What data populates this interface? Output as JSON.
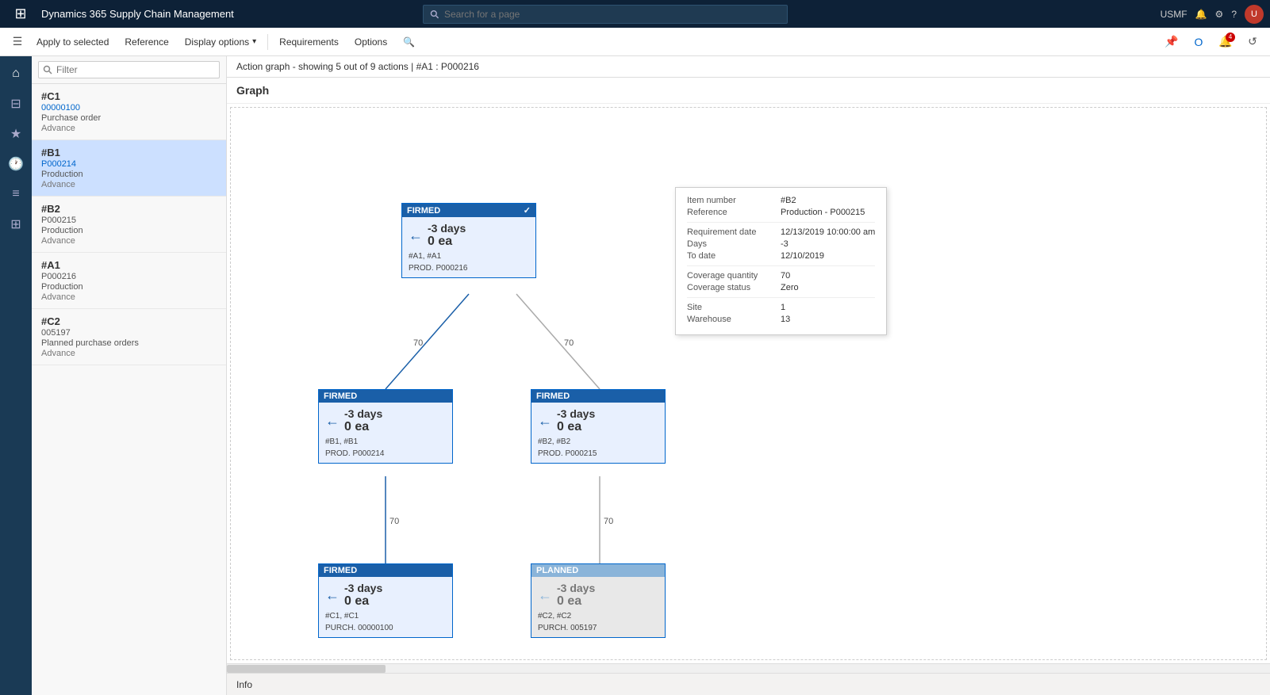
{
  "app": {
    "title": "Dynamics 365 Supply Chain Management",
    "app_icon": "⊞"
  },
  "search": {
    "placeholder": "Search for a page"
  },
  "topbar": {
    "user": "USMF"
  },
  "ribbon": {
    "apply_to_selected": "Apply to selected",
    "reference": "Reference",
    "display_options": "Display options",
    "requirements": "Requirements",
    "options": "Options"
  },
  "content": {
    "action_info": "Action graph - showing 5 out of 9 actions  |  #A1 : P000216",
    "graph_label": "Graph"
  },
  "list_items": [
    {
      "id": "#C1",
      "code": "00000100",
      "type": "Purchase order",
      "label": "Advance"
    },
    {
      "id": "#B1",
      "code": "P000214",
      "type": "Production",
      "label": "Advance",
      "selected": true
    },
    {
      "id": "#B2",
      "code": "P000215",
      "type": "Production",
      "label": "Advance"
    },
    {
      "id": "#A1",
      "code": "P000216",
      "type": "Production",
      "label": "Advance"
    },
    {
      "id": "#C2",
      "code": "005197",
      "type": "Planned purchase orders",
      "label": "Advance"
    }
  ],
  "nodes": {
    "top": {
      "status": "FIRMED",
      "days": "-3 days",
      "qty": "0 ea",
      "refs": "#A1, #A1",
      "prod": "PROD. P000216"
    },
    "mid_left": {
      "status": "FIRMED",
      "days": "-3 days",
      "qty": "0 ea",
      "refs": "#B1, #B1",
      "prod": "PROD. P000214"
    },
    "mid_right": {
      "status": "FIRMED",
      "days": "-3 days",
      "qty": "0 ea",
      "refs": "#B2, #B2",
      "prod": "PROD. P000215"
    },
    "bot_left": {
      "status": "FIRMED",
      "days": "-3 days",
      "qty": "0 ea",
      "refs": "#C1, #C1",
      "prod": "PURCH. 00000100"
    },
    "bot_right": {
      "status": "PLANNED",
      "days": "-3 days",
      "qty": "0 ea",
      "refs": "#C2, #C2",
      "prod": "PURCH. 005197"
    }
  },
  "edge_labels": {
    "top_mid_left": "70",
    "top_mid_right": "70",
    "mid_left_bot_left": "70",
    "mid_right_bot_right": "70"
  },
  "tooltip": {
    "item_number_label": "Item number",
    "item_number_val": "#B2",
    "reference_label": "Reference",
    "reference_val": "Production - P000215",
    "req_date_label": "Requirement date",
    "req_date_val": "12/13/2019 10:00:00 am",
    "days_label": "Days",
    "days_val": "-3",
    "to_date_label": "To date",
    "to_date_val": "12/10/2019",
    "cov_qty_label": "Coverage quantity",
    "cov_qty_val": "70",
    "cov_status_label": "Coverage status",
    "cov_status_val": "Zero",
    "site_label": "Site",
    "site_val": "1",
    "warehouse_label": "Warehouse",
    "warehouse_val": "13"
  },
  "bottom_bar": {
    "info_label": "Info"
  },
  "filter_placeholder": "Filter"
}
